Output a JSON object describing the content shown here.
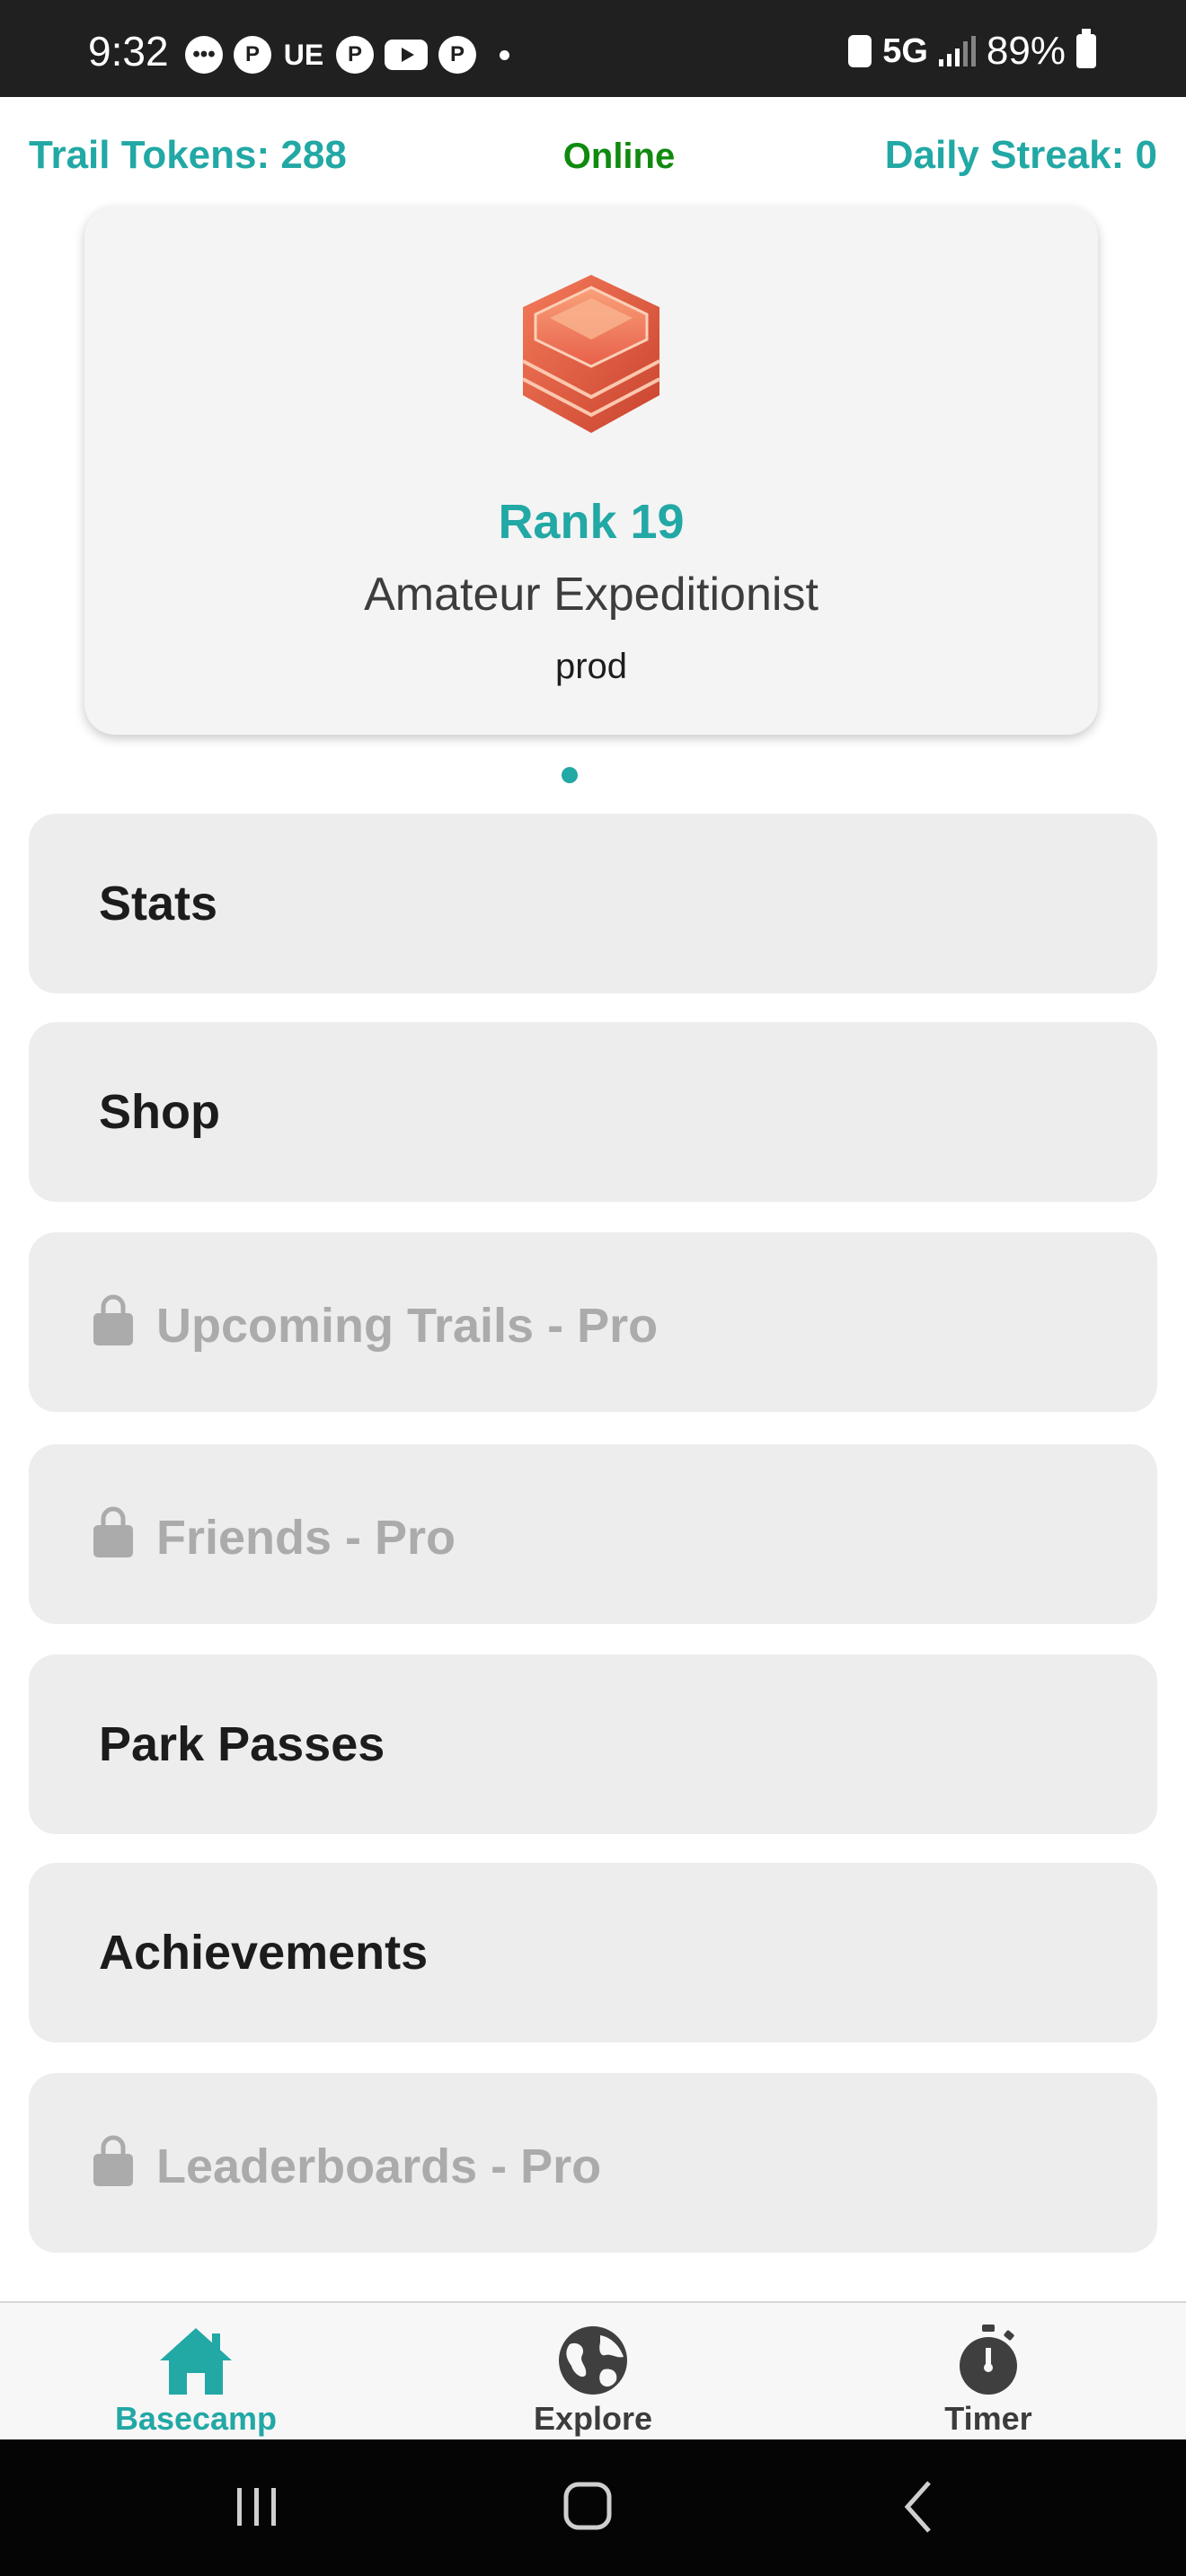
{
  "status_bar": {
    "time": "9:32",
    "left_icons": [
      "chat-bubble-icon",
      "pinterest-icon",
      "uber-eats-icon",
      "pinterest-icon",
      "youtube-icon",
      "pinterest-icon",
      "dot-icon"
    ],
    "ue_label": "UE",
    "network": "5G",
    "battery": "89%"
  },
  "header": {
    "tokens": "Trail Tokens: 288",
    "connection": "Online",
    "streak": "Daily Streak: 0"
  },
  "rank_card": {
    "badge_icon": "rank-badge-icon",
    "rank": "Rank 19",
    "title": "Amateur Expeditionist",
    "environment": "prod"
  },
  "menu": {
    "items": [
      {
        "label": "Stats",
        "locked": false
      },
      {
        "label": "Shop",
        "locked": false
      },
      {
        "label": "Upcoming Trails - Pro",
        "locked": true
      },
      {
        "label": "Friends - Pro",
        "locked": true
      },
      {
        "label": "Park Passes",
        "locked": false
      },
      {
        "label": "Achievements",
        "locked": false
      },
      {
        "label": "Leaderboards - Pro",
        "locked": true
      }
    ]
  },
  "bottom_nav": {
    "items": [
      {
        "label": "Basecamp",
        "icon": "home-icon",
        "active": true
      },
      {
        "label": "Explore",
        "icon": "globe-icon",
        "active": false
      },
      {
        "label": "Timer",
        "icon": "stopwatch-icon",
        "active": false
      }
    ]
  },
  "colors": {
    "accent": "#22a8a5",
    "online": "#0f8a0f",
    "menu_bg": "#ededed",
    "locked_text": "#ababab"
  }
}
